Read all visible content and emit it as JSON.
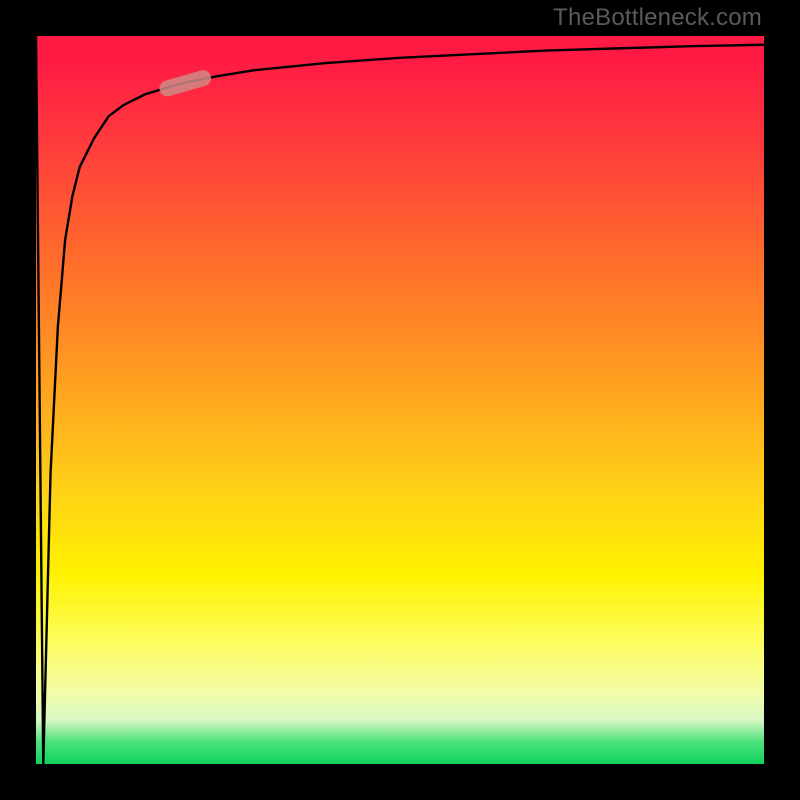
{
  "watermark": "TheBottleneck.com",
  "colors": {
    "background": "#000000",
    "gradient_stops": [
      {
        "pos": 0.0,
        "hex": "#ff1a44"
      },
      {
        "pos": 0.03,
        "hex": "#ff1a44"
      },
      {
        "pos": 0.15,
        "hex": "#ff3c3c"
      },
      {
        "pos": 0.3,
        "hex": "#ff6a2c"
      },
      {
        "pos": 0.47,
        "hex": "#ff9e20"
      },
      {
        "pos": 0.62,
        "hex": "#ffd018"
      },
      {
        "pos": 0.74,
        "hex": "#fff200"
      },
      {
        "pos": 0.83,
        "hex": "#fdfd5c"
      },
      {
        "pos": 0.9,
        "hex": "#f4fca6"
      },
      {
        "pos": 0.94,
        "hex": "#d6f7c4"
      },
      {
        "pos": 0.97,
        "hex": "#4be27a"
      },
      {
        "pos": 1.0,
        "hex": "#0fd25c"
      }
    ],
    "curve": "#000000",
    "marker_fill": "#cf8a86",
    "marker_stroke": "#ae6e6a"
  },
  "chart_data": {
    "type": "line",
    "title": "",
    "xlabel": "",
    "ylabel": "",
    "xlim": [
      0,
      100
    ],
    "ylim": [
      0,
      100
    ],
    "grid": false,
    "legend": false,
    "series": [
      {
        "name": "main-curve",
        "x": [
          0,
          1,
          2,
          3,
          4,
          5,
          6,
          8,
          10,
          12,
          15,
          20,
          25,
          30,
          40,
          50,
          60,
          70,
          80,
          90,
          100
        ],
        "values": [
          100,
          0,
          40,
          60,
          72,
          78,
          82,
          86,
          89,
          90.5,
          92,
          93.5,
          94.5,
          95.3,
          96.3,
          97,
          97.5,
          98,
          98.3,
          98.6,
          98.8
        ]
      }
    ],
    "annotations": [
      {
        "type": "marker",
        "name": "highlighted-segment",
        "shape": "capsule",
        "x_range": [
          17,
          24
        ],
        "y_range": [
          92.5,
          94.5
        ],
        "fill": "#cf8a86"
      }
    ]
  }
}
